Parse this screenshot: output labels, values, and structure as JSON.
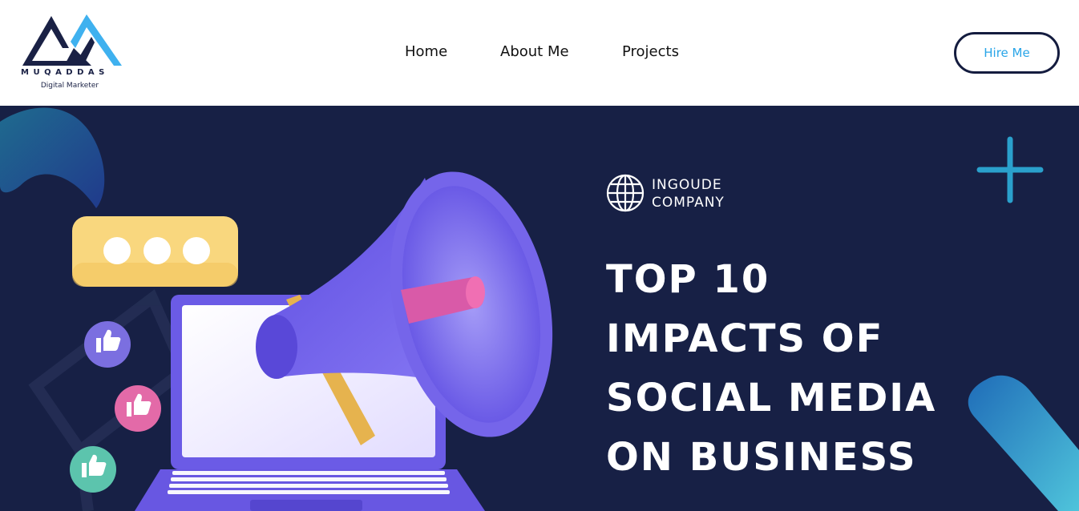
{
  "header": {
    "logo": {
      "name": "MUQADDAS",
      "tagline": "Digital Marketer",
      "icon": "mountain-logo-icon",
      "colors": {
        "dark": "#1a2145",
        "accent": "#3fb1ef"
      }
    },
    "nav": {
      "home": "Home",
      "about": "About Me",
      "projects": "Projects"
    },
    "hire_button": "Hire Me"
  },
  "hero": {
    "brand": {
      "icon": "globe-icon",
      "line1": "INGOUDE",
      "line2": "COMPANY"
    },
    "headline": [
      "TOP 10",
      "IMPACTS OF",
      "SOCIAL MEDIA",
      "ON BUSINESS"
    ],
    "illustration_icons": [
      "megaphone-icon",
      "laptop-icon",
      "chat-bubble-icon",
      "thumbs-up-icon",
      "plus-icon"
    ],
    "colors": {
      "background": "#172045",
      "megaphone": "#6c5ce7",
      "chat_bubble": "#f9d77e",
      "like_purple": "#7b6fe0",
      "like_pink": "#e36aa8",
      "like_teal": "#5cc4ad"
    }
  }
}
